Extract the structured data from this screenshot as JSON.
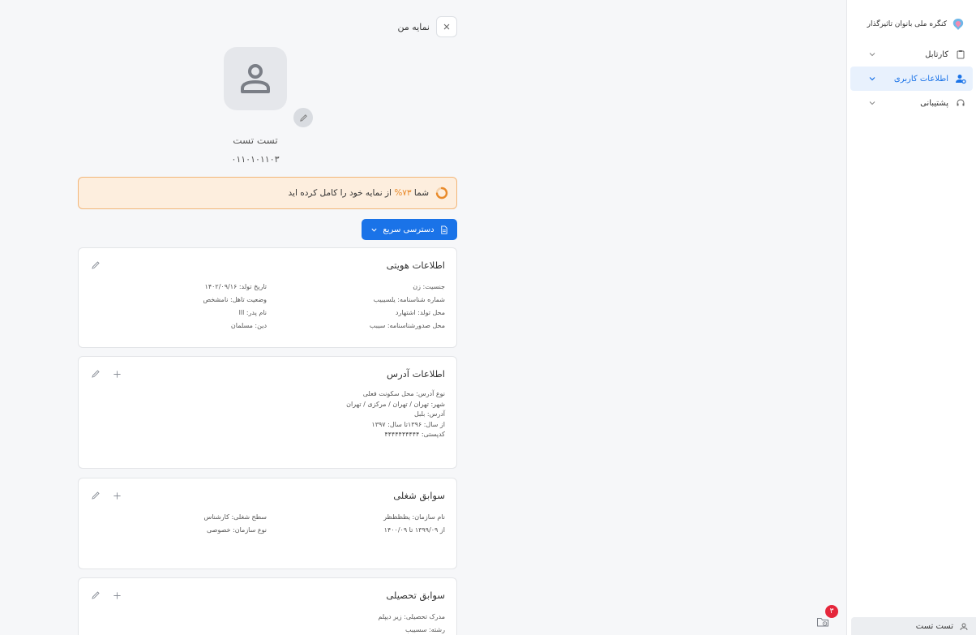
{
  "sidebar": {
    "brand_title": "کنگره ملی بانوان تاثیرگذار",
    "items": [
      {
        "label": "کارتابل",
        "icon": "clipboard-icon",
        "active": false
      },
      {
        "label": "اطلاعات کاربری",
        "icon": "user-settings-icon",
        "active": true
      },
      {
        "label": "پشتیبانی",
        "icon": "headset-icon",
        "active": false
      }
    ],
    "user_name": "تست تست"
  },
  "header": {
    "title": "نمایه من"
  },
  "profile": {
    "name": "تست تست",
    "id": "۰۱۱۰۱۰۱۱۰۳"
  },
  "completion": {
    "prefix": "شما",
    "percent": "۷۳%",
    "suffix": "از نمایه خود را کامل کرده اید",
    "value": 0.73,
    "color": "#e98a2a"
  },
  "quick_access": {
    "label": "دسترسی سریع"
  },
  "cards": {
    "identity": {
      "title": "اطلاعات هویتی",
      "col1": [
        "جنسیت: زن",
        "شماره شناسنامه: یلسیبیب",
        "محل تولد: اشتهارد",
        "محل صدورشناسنامه: سیبب"
      ],
      "col2": [
        "تاریخ تولد: ۱۴۰۲/۰۹/۱۶",
        "وضعیت تاهل: نامشخص",
        "نام پدر: ااا",
        "دین: مسلمان"
      ]
    },
    "address": {
      "title": "اطلاعات آدرس",
      "col1": [
        "نوع آدرس: محل سکونت فعلی",
        "شهر: تهران / تهران / مرکزی / تهران",
        "آدرس: بلبل",
        "از سال: ۱۳۹۶تا سال: ۱۳۹۷",
        "کدپستی: ۴۴۴۴۴۴۴۴۴۴"
      ]
    },
    "jobs": {
      "title": "سوابق شغلی",
      "col1": [
        "نام سازمان: یظظظظر",
        "از ۱۳۹۹/۰۹ تا ۱۴۰۰/۰۹"
      ],
      "col2": [
        "سطح شغلی: کارشناس",
        "نوع سازمان: خصوصی"
      ]
    },
    "education": {
      "title": "سوابق تحصیلی",
      "col1": [
        "مدرک تحصیلی: زیر دیپلم",
        "رشته: سسیبب"
      ]
    }
  },
  "notifications": {
    "count": "۳"
  },
  "colors": {
    "primary": "#1a73e8",
    "badge": "#e5263b",
    "warning_bg": "#fdeede",
    "warning_border": "#f2b679"
  }
}
